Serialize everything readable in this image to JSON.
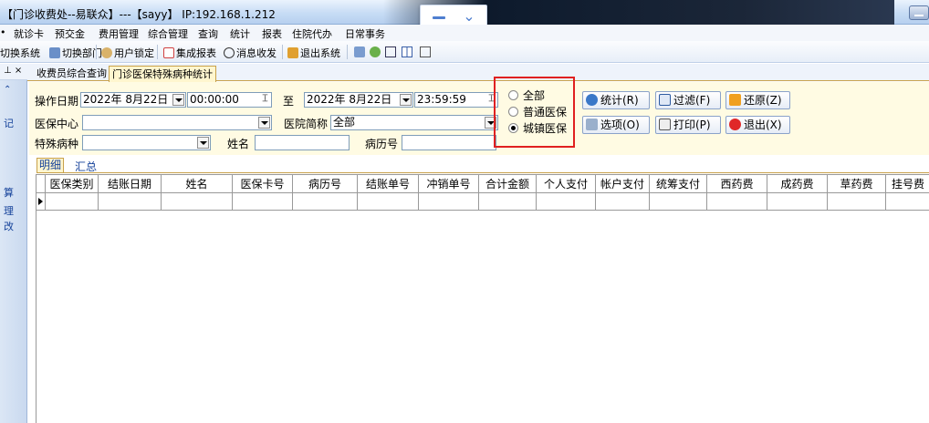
{
  "window": {
    "title": "【门诊收费处--易联众】---【sayy】 IP:192.168.1.212"
  },
  "menu": [
    "就诊卡",
    "预交金",
    "费用管理",
    "综合管理",
    "查询",
    "统计",
    "报表",
    "住院代办",
    "日常事务"
  ],
  "toolbar": {
    "switch_system": "切换系统",
    "switch_dept": "切换部门",
    "user_lock": "用户锁定",
    "integrated_report": "集成报表",
    "message": "消息收发",
    "exit_system": "退出系统"
  },
  "dock": {
    "pin": "⊥ ×",
    "items": [
      "记",
      "算",
      "理",
      "改"
    ]
  },
  "tabs": [
    "收费员综合查询",
    "门诊医保特殊病种统计"
  ],
  "form": {
    "date_label": "操作日期",
    "date_from": "2022年  8月22日",
    "time_from": "00:00:00",
    "to_label": "至",
    "date_to": "2022年  8月22日",
    "time_to": "23:59:59",
    "insurance_center_label": "医保中心",
    "insurance_center_value": "",
    "hospital_abbr_label": "医院简称",
    "hospital_abbr_value": "全部",
    "special_disease_label": "特殊病种",
    "special_disease_value": "",
    "name_label": "姓名",
    "name_value": "",
    "record_no_label": "病历号",
    "record_no_value": "",
    "radios": [
      {
        "label": "全部",
        "checked": false
      },
      {
        "label": "普通医保",
        "checked": false
      },
      {
        "label": "城镇医保",
        "checked": true
      }
    ]
  },
  "buttons": {
    "stats": "统计(R)",
    "filter": "过滤(F)",
    "restore": "还原(Z)",
    "options": "选项(O)",
    "print": "打印(P)",
    "exit": "退出(X)"
  },
  "subtabs": [
    "明细",
    "汇总"
  ],
  "grid": {
    "columns": [
      "医保类别",
      "结账日期",
      "姓名",
      "医保卡号",
      "病历号",
      "结账单号",
      "冲销单号",
      "合计金额",
      "个人支付",
      "帐户支付",
      "统筹支付",
      "西药费",
      "成药费",
      "草药费",
      "挂号费"
    ]
  },
  "colors": {
    "highlight_border": "#e02020",
    "form_background": "#fffbe3",
    "titlebar": "#c7dcf5"
  }
}
